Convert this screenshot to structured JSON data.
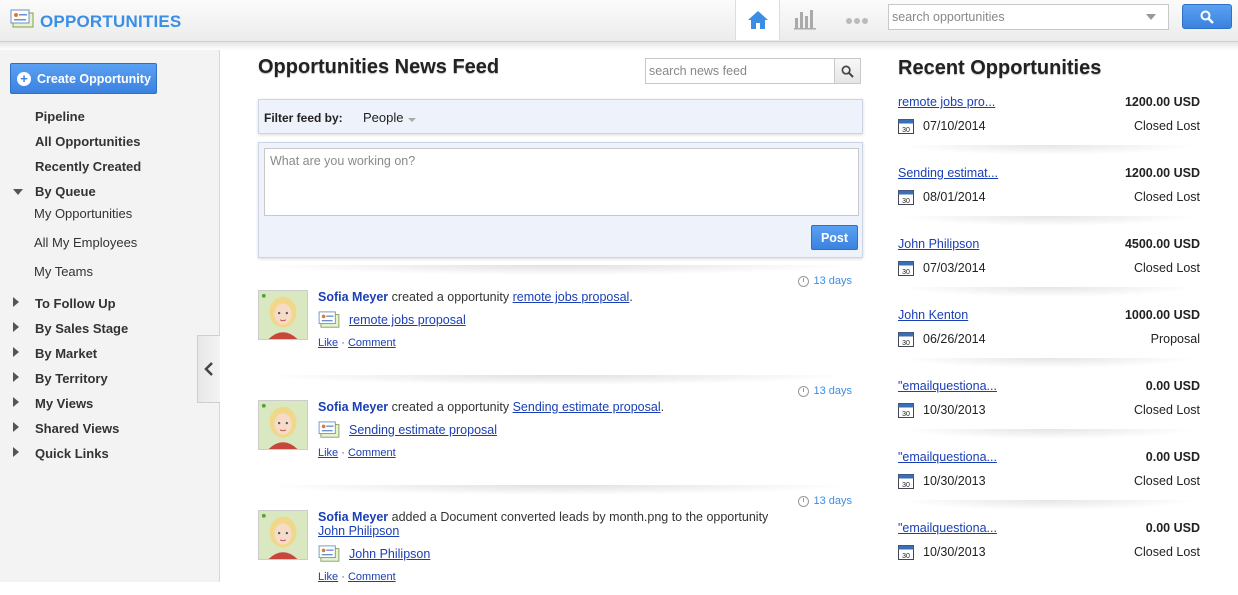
{
  "app": {
    "title": "OPPORTUNITIES",
    "logo_icon": "opportunity-logo-icon",
    "accent_color": "#3a8ee6"
  },
  "header": {
    "search_placeholder": "search opportunities",
    "nav_icons": [
      "home-icon",
      "chart-icon",
      "more-icon"
    ]
  },
  "sidebar": {
    "create_label": "Create Opportunity",
    "items": [
      {
        "label": "Pipeline"
      },
      {
        "label": "All Opportunities"
      },
      {
        "label": "Recently Created"
      },
      {
        "label": "By Queue",
        "expanded": true
      },
      {
        "label": "My Opportunities"
      },
      {
        "label": "All My Employees"
      },
      {
        "label": "My Teams"
      },
      {
        "label": "To Follow Up"
      },
      {
        "label": "By Sales Stage"
      },
      {
        "label": "By Market"
      },
      {
        "label": "By Territory"
      },
      {
        "label": "My Views"
      },
      {
        "label": "Shared Views"
      },
      {
        "label": "Quick Links"
      }
    ]
  },
  "feed": {
    "title": "Opportunities News Feed",
    "search_placeholder": "search news feed",
    "filter_label": "Filter feed by:",
    "filter_value": "People",
    "composer_placeholder": "What are you working on?",
    "post_label": "Post",
    "items": [
      {
        "time": "13 days",
        "user": "Sofia Meyer",
        "action": "created a opportunity",
        "target": "remote jobs proposal",
        "suffix": ".",
        "link": "remote jobs proposal",
        "like": "Like",
        "comment": "Comment"
      },
      {
        "time": "13 days",
        "user": "Sofia Meyer",
        "action": "created a opportunity",
        "target": "Sending estimate proposal",
        "suffix": ".",
        "link": "Sending estimate proposal",
        "like": "Like",
        "comment": "Comment"
      },
      {
        "time": "13 days",
        "user": "Sofia Meyer",
        "action": "added a Document converted leads by month.png to the opportunity",
        "target": "John Philipson",
        "suffix": "",
        "link": "John Philipson",
        "like": "Like",
        "comment": "Comment"
      }
    ]
  },
  "recent": {
    "title": "Recent Opportunities",
    "items": [
      {
        "name": "remote jobs pro...",
        "amount": "1200.00 USD",
        "date": "07/10/2014",
        "stage": "Closed Lost"
      },
      {
        "name": "Sending estimat...",
        "amount": "1200.00 USD",
        "date": "08/01/2014",
        "stage": "Closed Lost"
      },
      {
        "name": "John Philipson",
        "amount": "4500.00 USD",
        "date": "07/03/2014",
        "stage": "Closed Lost"
      },
      {
        "name": "John Kenton",
        "amount": "1000.00 USD",
        "date": "06/26/2014",
        "stage": "Proposal"
      },
      {
        "name": "\"emailquestiona...",
        "amount": "0.00 USD",
        "date": "10/30/2013",
        "stage": "Closed Lost"
      },
      {
        "name": "\"emailquestiona...",
        "amount": "0.00 USD",
        "date": "10/30/2013",
        "stage": "Closed Lost"
      },
      {
        "name": "\"emailquestiona...",
        "amount": "0.00 USD",
        "date": "10/30/2013",
        "stage": "Closed Lost"
      }
    ]
  }
}
